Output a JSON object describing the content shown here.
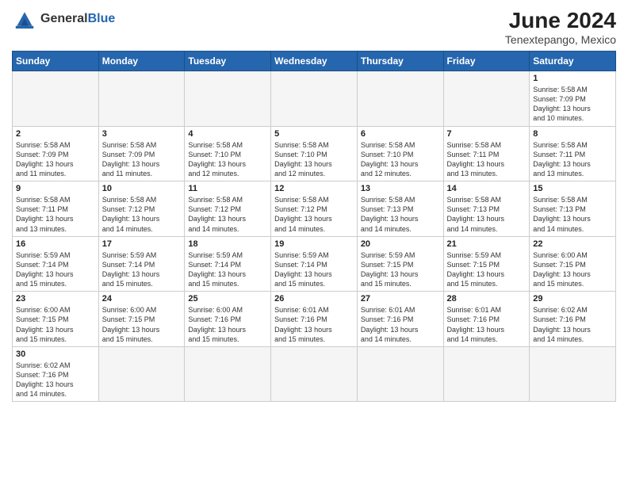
{
  "header": {
    "logo_general": "General",
    "logo_blue": "Blue",
    "month_title": "June 2024",
    "location": "Tenextepango, Mexico"
  },
  "weekdays": [
    "Sunday",
    "Monday",
    "Tuesday",
    "Wednesday",
    "Thursday",
    "Friday",
    "Saturday"
  ],
  "weeks": [
    [
      {
        "day": "",
        "info": ""
      },
      {
        "day": "",
        "info": ""
      },
      {
        "day": "",
        "info": ""
      },
      {
        "day": "",
        "info": ""
      },
      {
        "day": "",
        "info": ""
      },
      {
        "day": "",
        "info": ""
      },
      {
        "day": "1",
        "info": "Sunrise: 5:58 AM\nSunset: 7:09 PM\nDaylight: 13 hours\nand 10 minutes."
      }
    ],
    [
      {
        "day": "2",
        "info": "Sunrise: 5:58 AM\nSunset: 7:09 PM\nDaylight: 13 hours\nand 11 minutes."
      },
      {
        "day": "3",
        "info": "Sunrise: 5:58 AM\nSunset: 7:09 PM\nDaylight: 13 hours\nand 11 minutes."
      },
      {
        "day": "4",
        "info": "Sunrise: 5:58 AM\nSunset: 7:10 PM\nDaylight: 13 hours\nand 12 minutes."
      },
      {
        "day": "5",
        "info": "Sunrise: 5:58 AM\nSunset: 7:10 PM\nDaylight: 13 hours\nand 12 minutes."
      },
      {
        "day": "6",
        "info": "Sunrise: 5:58 AM\nSunset: 7:10 PM\nDaylight: 13 hours\nand 12 minutes."
      },
      {
        "day": "7",
        "info": "Sunrise: 5:58 AM\nSunset: 7:11 PM\nDaylight: 13 hours\nand 13 minutes."
      },
      {
        "day": "8",
        "info": "Sunrise: 5:58 AM\nSunset: 7:11 PM\nDaylight: 13 hours\nand 13 minutes."
      }
    ],
    [
      {
        "day": "9",
        "info": "Sunrise: 5:58 AM\nSunset: 7:11 PM\nDaylight: 13 hours\nand 13 minutes."
      },
      {
        "day": "10",
        "info": "Sunrise: 5:58 AM\nSunset: 7:12 PM\nDaylight: 13 hours\nand 14 minutes."
      },
      {
        "day": "11",
        "info": "Sunrise: 5:58 AM\nSunset: 7:12 PM\nDaylight: 13 hours\nand 14 minutes."
      },
      {
        "day": "12",
        "info": "Sunrise: 5:58 AM\nSunset: 7:12 PM\nDaylight: 13 hours\nand 14 minutes."
      },
      {
        "day": "13",
        "info": "Sunrise: 5:58 AM\nSunset: 7:13 PM\nDaylight: 13 hours\nand 14 minutes."
      },
      {
        "day": "14",
        "info": "Sunrise: 5:58 AM\nSunset: 7:13 PM\nDaylight: 13 hours\nand 14 minutes."
      },
      {
        "day": "15",
        "info": "Sunrise: 5:58 AM\nSunset: 7:13 PM\nDaylight: 13 hours\nand 14 minutes."
      }
    ],
    [
      {
        "day": "16",
        "info": "Sunrise: 5:59 AM\nSunset: 7:14 PM\nDaylight: 13 hours\nand 15 minutes."
      },
      {
        "day": "17",
        "info": "Sunrise: 5:59 AM\nSunset: 7:14 PM\nDaylight: 13 hours\nand 15 minutes."
      },
      {
        "day": "18",
        "info": "Sunrise: 5:59 AM\nSunset: 7:14 PM\nDaylight: 13 hours\nand 15 minutes."
      },
      {
        "day": "19",
        "info": "Sunrise: 5:59 AM\nSunset: 7:14 PM\nDaylight: 13 hours\nand 15 minutes."
      },
      {
        "day": "20",
        "info": "Sunrise: 5:59 AM\nSunset: 7:15 PM\nDaylight: 13 hours\nand 15 minutes."
      },
      {
        "day": "21",
        "info": "Sunrise: 5:59 AM\nSunset: 7:15 PM\nDaylight: 13 hours\nand 15 minutes."
      },
      {
        "day": "22",
        "info": "Sunrise: 6:00 AM\nSunset: 7:15 PM\nDaylight: 13 hours\nand 15 minutes."
      }
    ],
    [
      {
        "day": "23",
        "info": "Sunrise: 6:00 AM\nSunset: 7:15 PM\nDaylight: 13 hours\nand 15 minutes."
      },
      {
        "day": "24",
        "info": "Sunrise: 6:00 AM\nSunset: 7:15 PM\nDaylight: 13 hours\nand 15 minutes."
      },
      {
        "day": "25",
        "info": "Sunrise: 6:00 AM\nSunset: 7:16 PM\nDaylight: 13 hours\nand 15 minutes."
      },
      {
        "day": "26",
        "info": "Sunrise: 6:01 AM\nSunset: 7:16 PM\nDaylight: 13 hours\nand 15 minutes."
      },
      {
        "day": "27",
        "info": "Sunrise: 6:01 AM\nSunset: 7:16 PM\nDaylight: 13 hours\nand 14 minutes."
      },
      {
        "day": "28",
        "info": "Sunrise: 6:01 AM\nSunset: 7:16 PM\nDaylight: 13 hours\nand 14 minutes."
      },
      {
        "day": "29",
        "info": "Sunrise: 6:02 AM\nSunset: 7:16 PM\nDaylight: 13 hours\nand 14 minutes."
      }
    ],
    [
      {
        "day": "30",
        "info": "Sunrise: 6:02 AM\nSunset: 7:16 PM\nDaylight: 13 hours\nand 14 minutes."
      },
      {
        "day": "",
        "info": ""
      },
      {
        "day": "",
        "info": ""
      },
      {
        "day": "",
        "info": ""
      },
      {
        "day": "",
        "info": ""
      },
      {
        "day": "",
        "info": ""
      },
      {
        "day": "",
        "info": ""
      }
    ]
  ]
}
